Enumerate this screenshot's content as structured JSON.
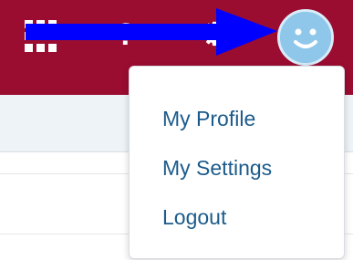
{
  "header": {
    "icons": [
      {
        "name": "app-launcher-icon"
      },
      {
        "name": "help-icon",
        "glyph": "?"
      },
      {
        "name": "setup-icon",
        "glyph": "⚙"
      },
      {
        "name": "avatar-icon"
      }
    ],
    "colors": {
      "bar": "#9b0c31",
      "avatar": "#8ec7ea",
      "arrow": "#0000ff"
    }
  },
  "user_menu": {
    "items": [
      {
        "label": "My Profile"
      },
      {
        "label": "My Settings"
      },
      {
        "label": "Logout"
      }
    ],
    "link_color": "#1b5b8b"
  }
}
